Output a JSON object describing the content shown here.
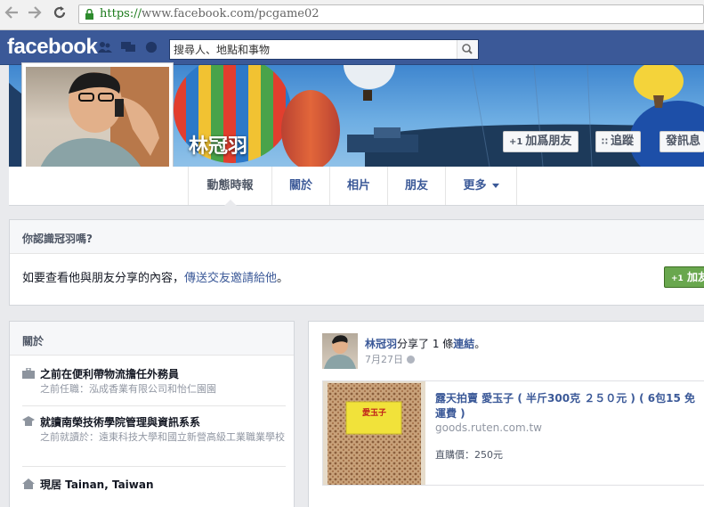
{
  "browser": {
    "back_icon": "arrow-left-icon",
    "forward_icon": "arrow-right-icon",
    "reload_icon": "reload-icon",
    "url_protocol": "https://",
    "url_rest": "www.facebook.com/pcgame02"
  },
  "topbar": {
    "logo": "facebook",
    "search_placeholder": "搜尋人、地點和事物"
  },
  "profile": {
    "name": "林冠羽",
    "buttons": {
      "add_friend": "加爲朋友",
      "follow": "追蹤",
      "message": "發訊息"
    }
  },
  "nav": {
    "tabs": [
      {
        "label": "動態時報"
      },
      {
        "label": "關於"
      },
      {
        "label": "相片"
      },
      {
        "label": "朋友"
      },
      {
        "label": "更多"
      }
    ]
  },
  "know": {
    "title": "你認識冠羽嗎?",
    "text_before": "如要查看他與朋友分享的內容，",
    "link": "傳送交友邀請給他",
    "text_after": "。",
    "add_button": "加友"
  },
  "about": {
    "title": "關於",
    "items": [
      {
        "main": "之前在便利帶物流擔任外務員",
        "sub": "之前任職：泓成香業有限公司和怡仁園園"
      },
      {
        "main": "就讀南榮技術學院管理與資訊系系",
        "sub": "之前就讀於：遠東科技大學和國立新營高級工業職業學校"
      },
      {
        "main": "現居 Tainan, Taiwan",
        "sub": ""
      }
    ]
  },
  "story": {
    "author": "林冠羽",
    "action": "分享了 1 條",
    "link_word": "連結",
    "period": "。",
    "date": "7月27日",
    "share": {
      "thumb_label": "愛玉子",
      "title": "露天拍賣 愛玉子 ( 半斤300克 ２５０元 ) ( 6包15 免運費 )",
      "domain": "goods.ruten.com.tw",
      "price": "直購價：250元"
    }
  },
  "colors": {
    "fb_blue": "#3b5998",
    "green_button": "#69a74e",
    "page_bg": "#e9eaed"
  }
}
